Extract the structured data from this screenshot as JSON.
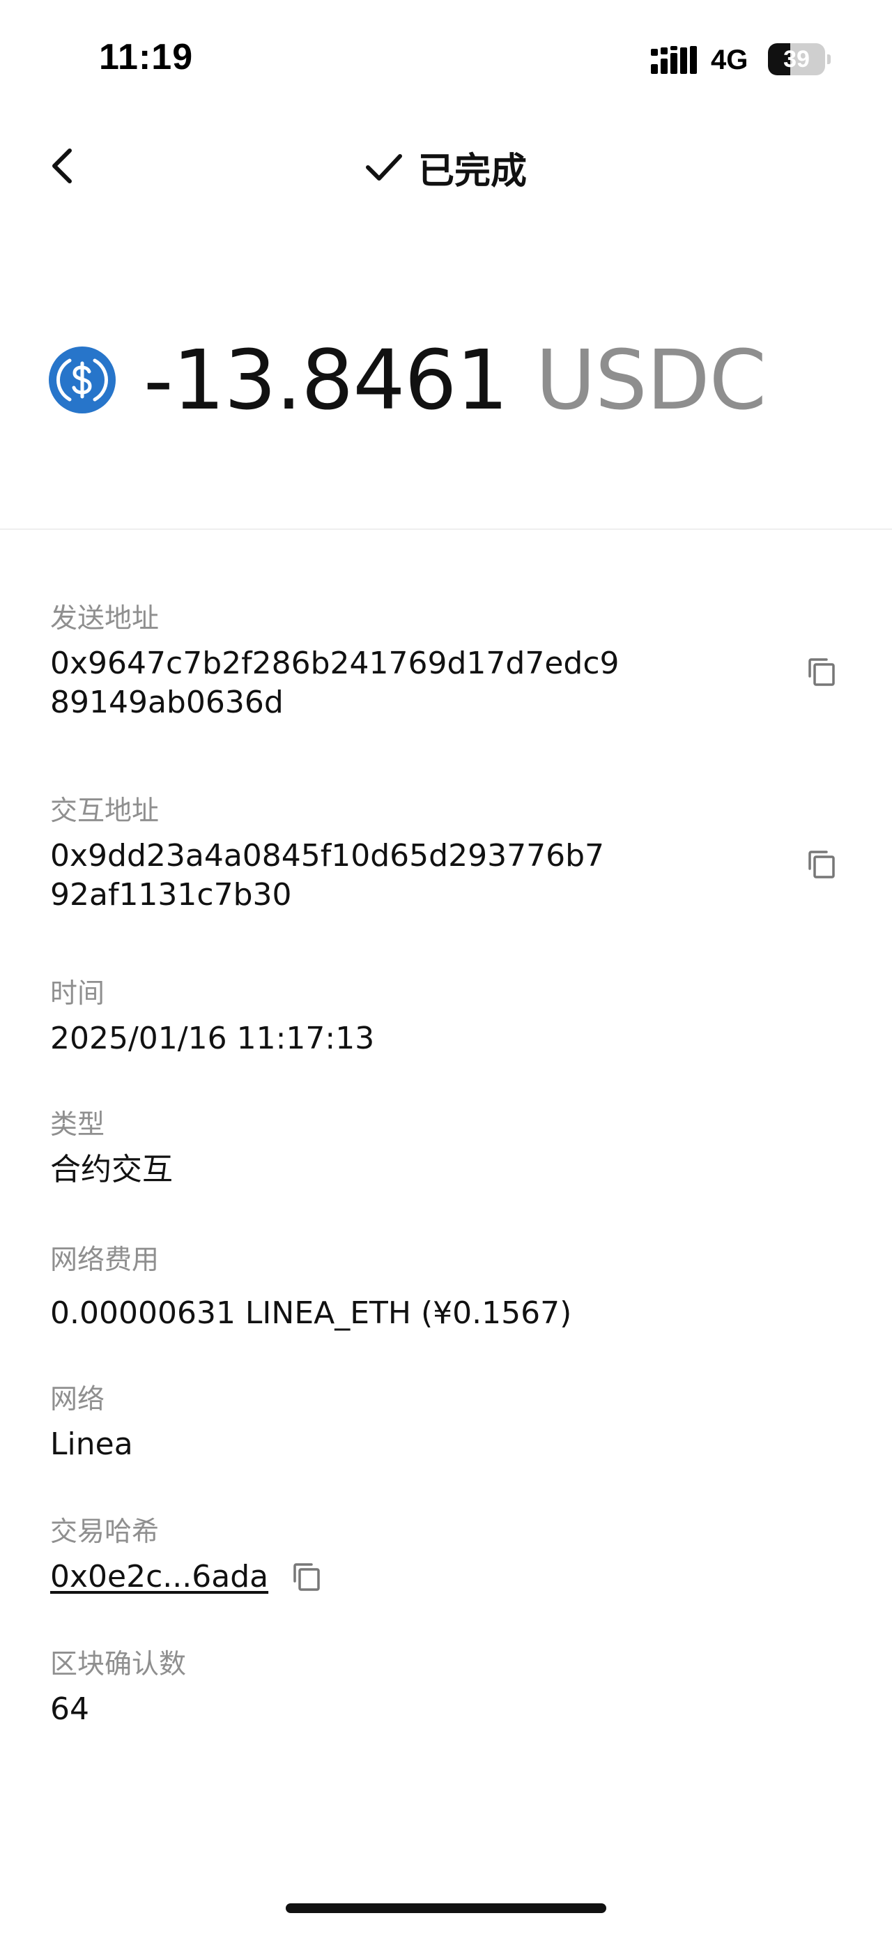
{
  "status_bar": {
    "time": "11:19",
    "network": "4G",
    "battery_level": "39",
    "battery_fraction": 0.39
  },
  "header": {
    "back_icon": "chevron-left-icon",
    "status_icon": "check-icon",
    "title": "已完成"
  },
  "amount": {
    "token_icon": "usdc-icon",
    "value": "-13.8461",
    "unit": "USDC",
    "colors": {
      "token": "#2775CA",
      "value": "#111111",
      "unit": "#8E8E8E"
    }
  },
  "details": {
    "sender": {
      "label": "发送地址",
      "value": "0x9647c7b2f286b241769d17d7edc989149ab0636d"
    },
    "contract": {
      "label": "交互地址",
      "value": "0x9dd23a4a0845f10d65d293776b792af1131c7b30"
    },
    "time": {
      "label": "时间",
      "value": "2025/01/16 11:17:13"
    },
    "type": {
      "label": "类型",
      "value": "合约交互"
    },
    "fee": {
      "label": "网络费用",
      "value": "0.00000631 LINEA_ETH (¥0.1567)"
    },
    "network": {
      "label": "网络",
      "value": "Linea"
    },
    "tx_hash": {
      "label": "交易哈希",
      "value": "0x0e2c...6ada"
    },
    "confirmations": {
      "label": "区块确认数",
      "value": "64"
    }
  }
}
